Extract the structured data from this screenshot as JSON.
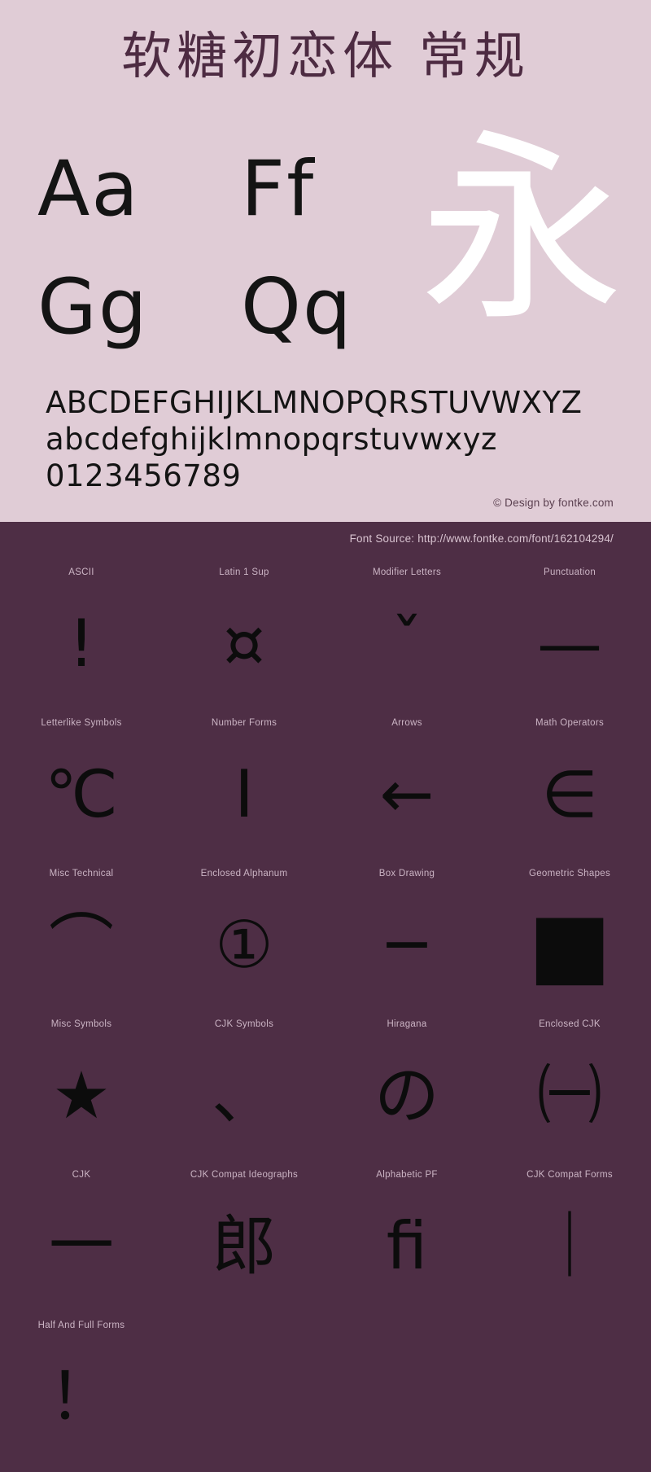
{
  "specimen": {
    "title": "软糖初恋体  常规",
    "sample_pairs": [
      "Aa",
      "Ff",
      "Gg",
      "Qq"
    ],
    "hero_glyph": "永",
    "alphabet_uppercase": "ABCDEFGHIJKLMNOPQRSTUVWXYZ",
    "alphabet_lowercase": "abcdefghijklmnopqrstuvwxyz",
    "digits": "0123456789",
    "copyright": "© Design by fontke.com",
    "background_color": "#e0ccd6",
    "title_color": "#4d2b42",
    "hero_color": "#ffffff"
  },
  "blocks_section": {
    "font_source": "Font Source: http://www.fontke.com/font/162104294/",
    "background_color": "#4e2e45",
    "label_color": "#cbb4c4",
    "glyph_color": "#0c0c0c",
    "blocks": [
      {
        "label": "ASCII",
        "glyph": "!"
      },
      {
        "label": "Latin 1 Sup",
        "glyph": "¤"
      },
      {
        "label": "Modifier Letters",
        "glyph": "ˇ"
      },
      {
        "label": "Punctuation",
        "glyph": "—"
      },
      {
        "label": "Letterlike Symbols",
        "glyph": "℃"
      },
      {
        "label": "Number Forms",
        "glyph": "Ⅰ"
      },
      {
        "label": "Arrows",
        "glyph": "←"
      },
      {
        "label": "Math Operators",
        "glyph": "∈"
      },
      {
        "label": "Misc Technical",
        "glyph": "⌒"
      },
      {
        "label": "Enclosed Alphanum",
        "glyph": "①"
      },
      {
        "label": "Box Drawing",
        "glyph": "─"
      },
      {
        "label": "Geometric Shapes",
        "glyph": "■"
      },
      {
        "label": "Misc Symbols",
        "glyph": "★"
      },
      {
        "label": "CJK Symbols",
        "glyph": "、"
      },
      {
        "label": "Hiragana",
        "glyph": "の"
      },
      {
        "label": "Enclosed CJK",
        "glyph": "㈠"
      },
      {
        "label": "CJK",
        "glyph": "一"
      },
      {
        "label": "CJK Compat Ideographs",
        "glyph": "郎"
      },
      {
        "label": "Alphabetic PF",
        "glyph": "ﬁ"
      },
      {
        "label": "CJK Compat Forms",
        "glyph": "｜"
      },
      {
        "label": "Half And Full Forms",
        "glyph": "！"
      }
    ]
  }
}
